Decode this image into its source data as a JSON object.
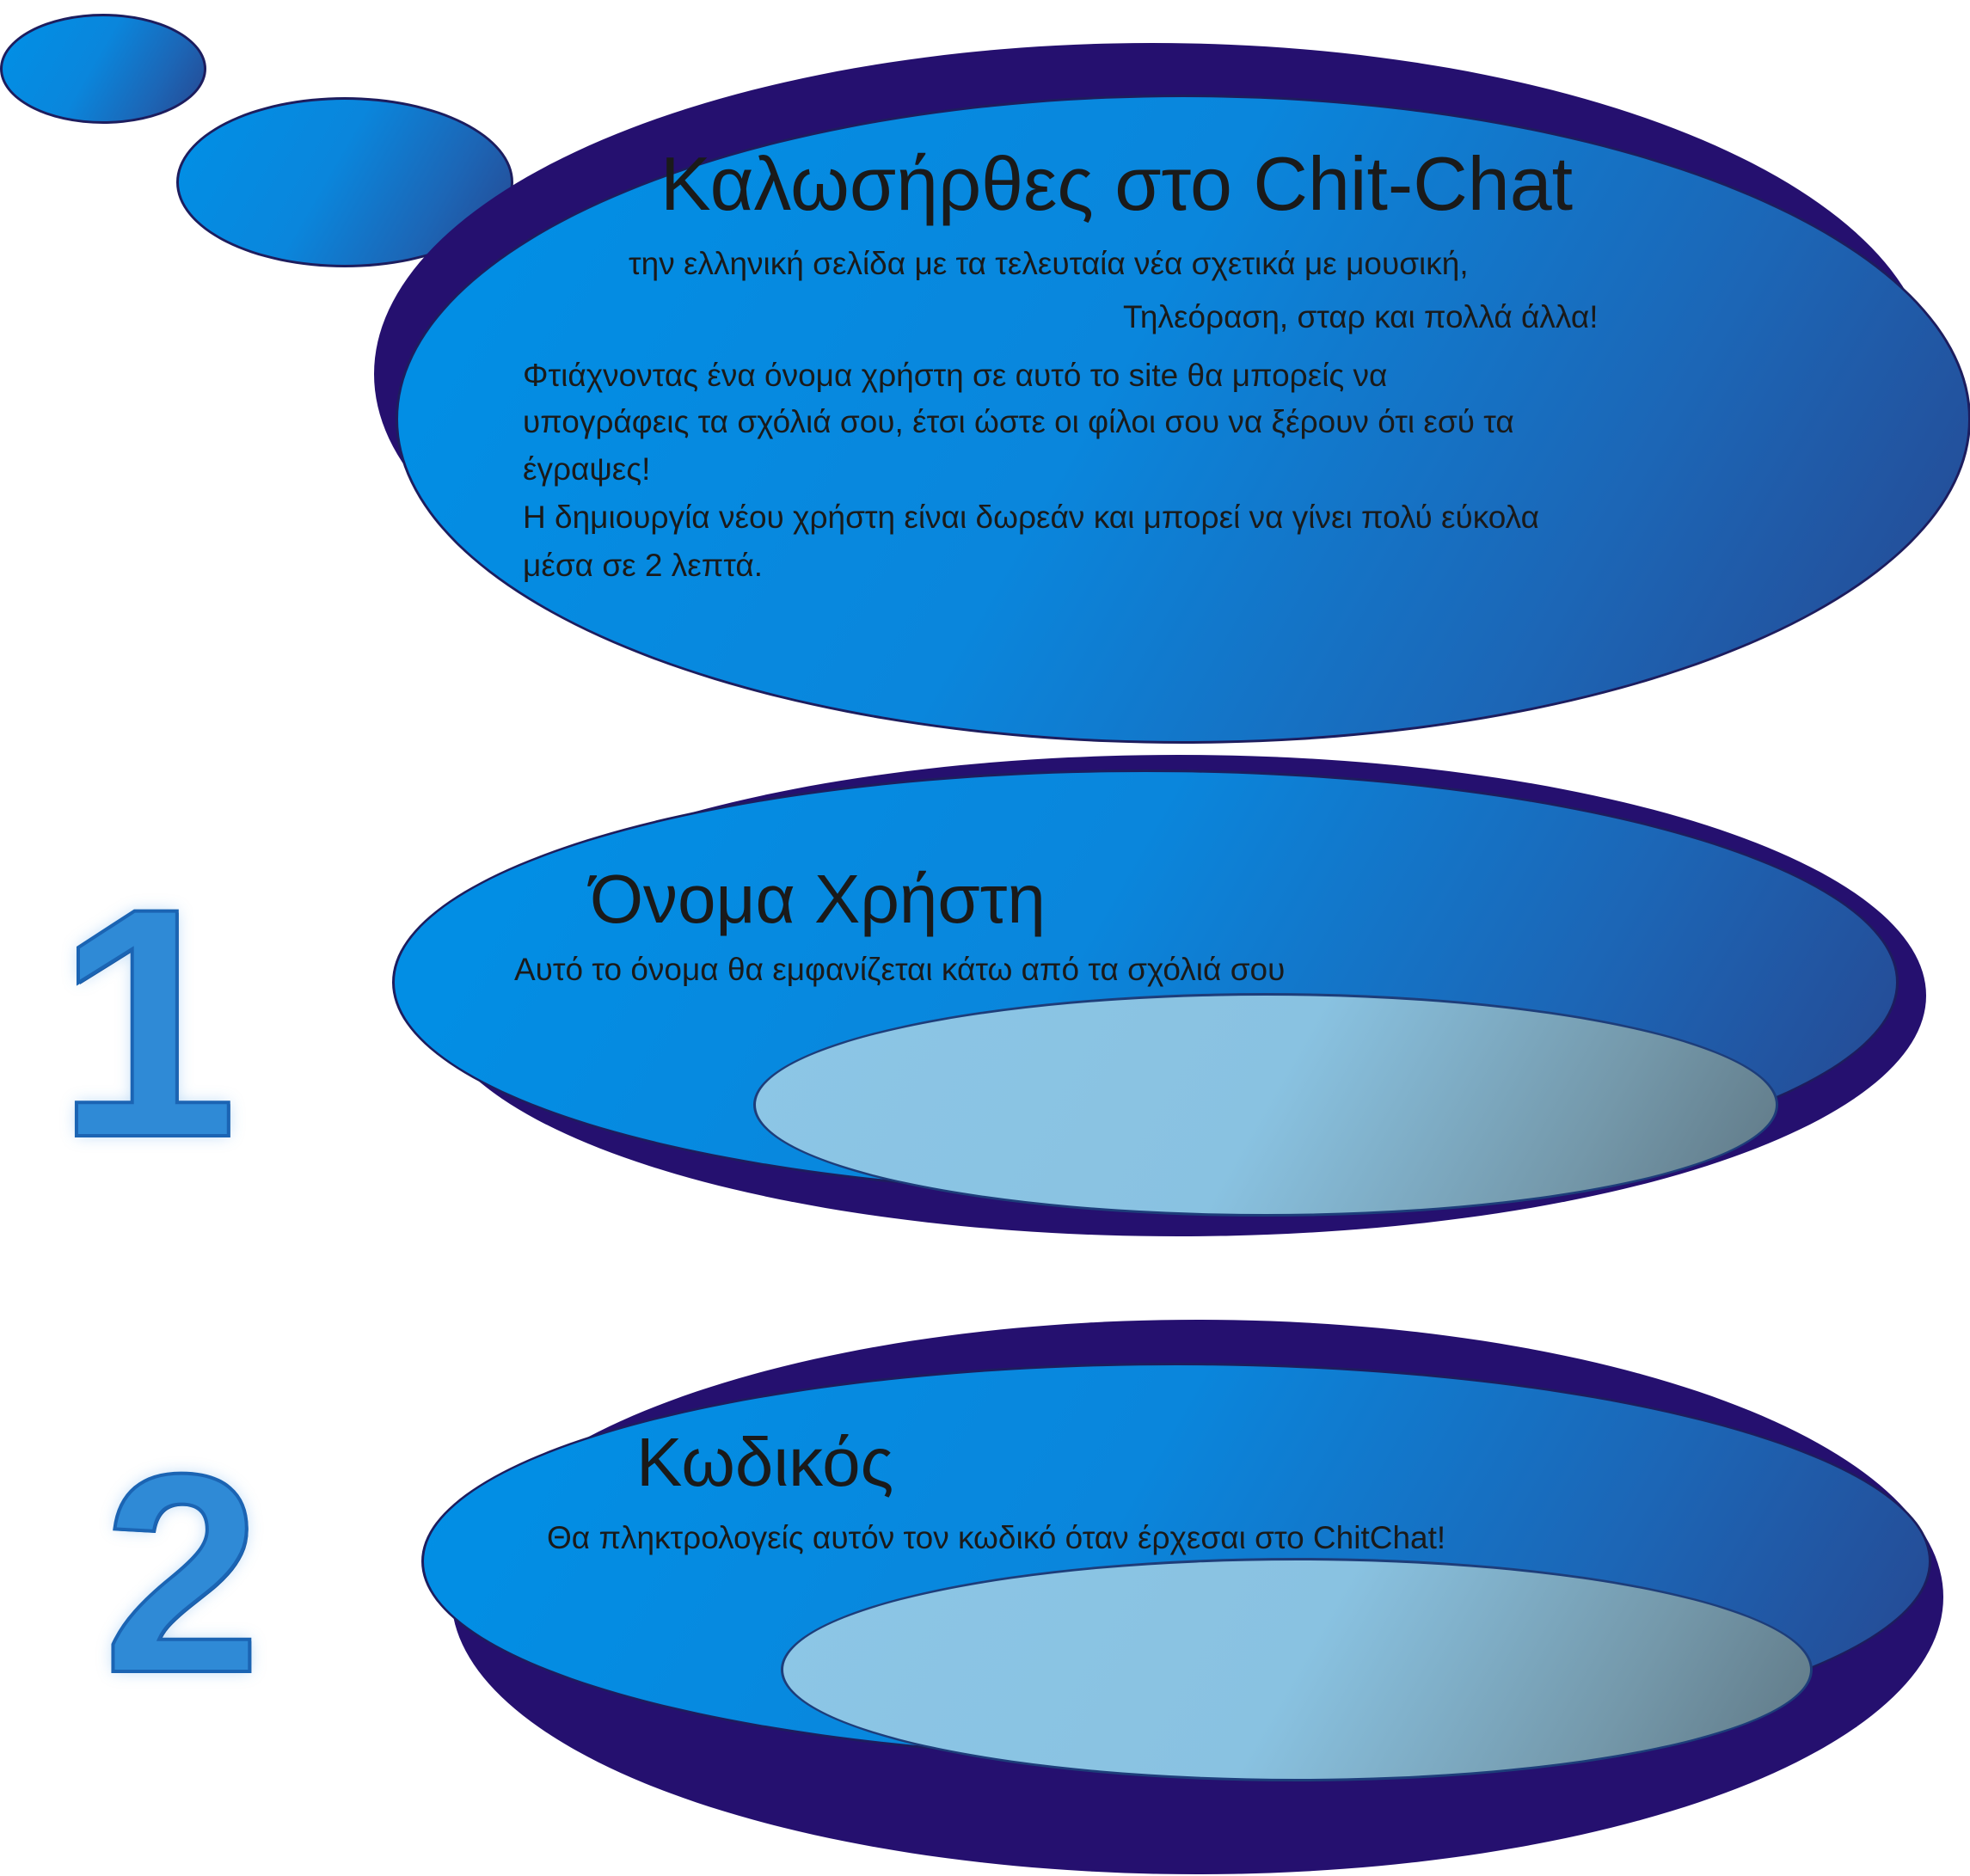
{
  "welcome": {
    "title": "Καλωσήρθες στο Chit-Chat",
    "line1": "την ελληνική σελίδα με τα τελευταία νέα σχετικά με μουσική,",
    "line2": "Τηλεόραση, σταρ και πολλά άλλα!",
    "para1_line1": "Φτιάχνοντας ένα όνομα χρήστη σε αυτό το site θα μπορείς να",
    "para1_line2": "υπογράφεις τα σχόλιά σου, έτσι ώστε οι φίλοι σου να ξέρουν ότι εσύ τα",
    "para1_line3": "έγραψες!",
    "para2_line1": "Η δημιουργία νέου χρήστη είναι δωρεάν και μπορεί να γίνει πολύ εύκολα",
    "para2_line2": "μέσα σε 2 λεπτά."
  },
  "step1": {
    "number": "1",
    "title": "Όνομα Χρήστη",
    "hint": "Αυτό το όνομα θα εμφανίζεται κάτω από τα σχόλιά σου"
  },
  "step2": {
    "number": "2",
    "title": "Κωδικός",
    "hint": "Θα πληκτρολογείς αυτόν τον κωδικό όταν έρχεσαι στο ChitChat!"
  },
  "colors": {
    "bubble_blue": "#0090e6",
    "bubble_dark_edge": "#27468f",
    "shadow_navy": "#25106f",
    "field_light": "#8cc6e6",
    "number_blue": "#2f8ad6"
  }
}
